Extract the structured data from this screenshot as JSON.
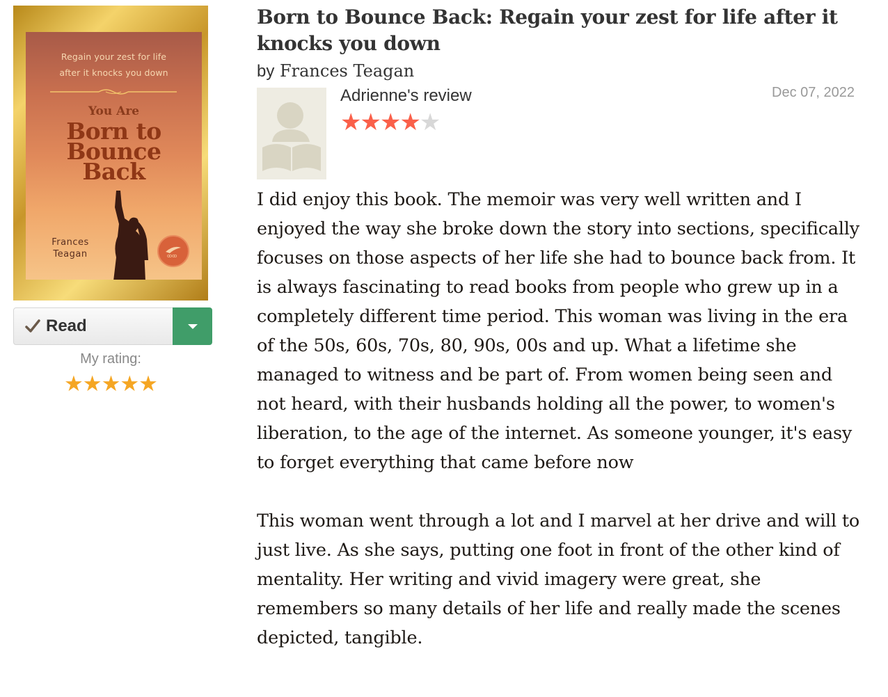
{
  "cover": {
    "subtitle": "Regain your zest for life\nafter it knocks you down",
    "kicker": "You Are",
    "title": "Born to\nBounce\nBack",
    "author": "Frances\nTeagan"
  },
  "shelf": {
    "status_label": "Read",
    "my_rating_label": "My rating:",
    "my_rating_value": 5,
    "my_rating_stars": "★★★★★"
  },
  "book": {
    "title": "Born to Bounce Back: Regain your zest for life after it knocks you down",
    "by": "by",
    "author": "Frances Teagan"
  },
  "review": {
    "reviewer_name": "Adrienne",
    "reviewer_suffix": "'s review",
    "date": "Dec 07, 2022",
    "rating": 4,
    "stars_on": "★★★★",
    "stars_off": "★",
    "paragraphs": [
      "I did enjoy this book. The memoir was very well written and I enjoyed the way she broke down the story into sections, specifically focuses on those aspects of her life she had to bounce back from. It is always fascinating to read books from people who grew up in a completely different time period. This woman was living in the era of the 50s, 60s, 70s, 80, 90s, 00s and up. What a lifetime she managed to witness and be part of. From women being seen and not heard, with their husbands holding all the power, to women's liberation, to the age of the internet. As someone younger, it's easy to forget everything that came before now",
      "This woman went through a lot and I marvel at her drive and will to just live. As she says, putting one foot in front of the other kind of mentality. Her writing and vivid imagery were great, she remembers so many details of her life and really made the scenes depicted, tangible."
    ]
  },
  "colors": {
    "review_star": "#fa604a",
    "my_rating_star": "#f5a623",
    "dropdown_green": "#409d69"
  }
}
